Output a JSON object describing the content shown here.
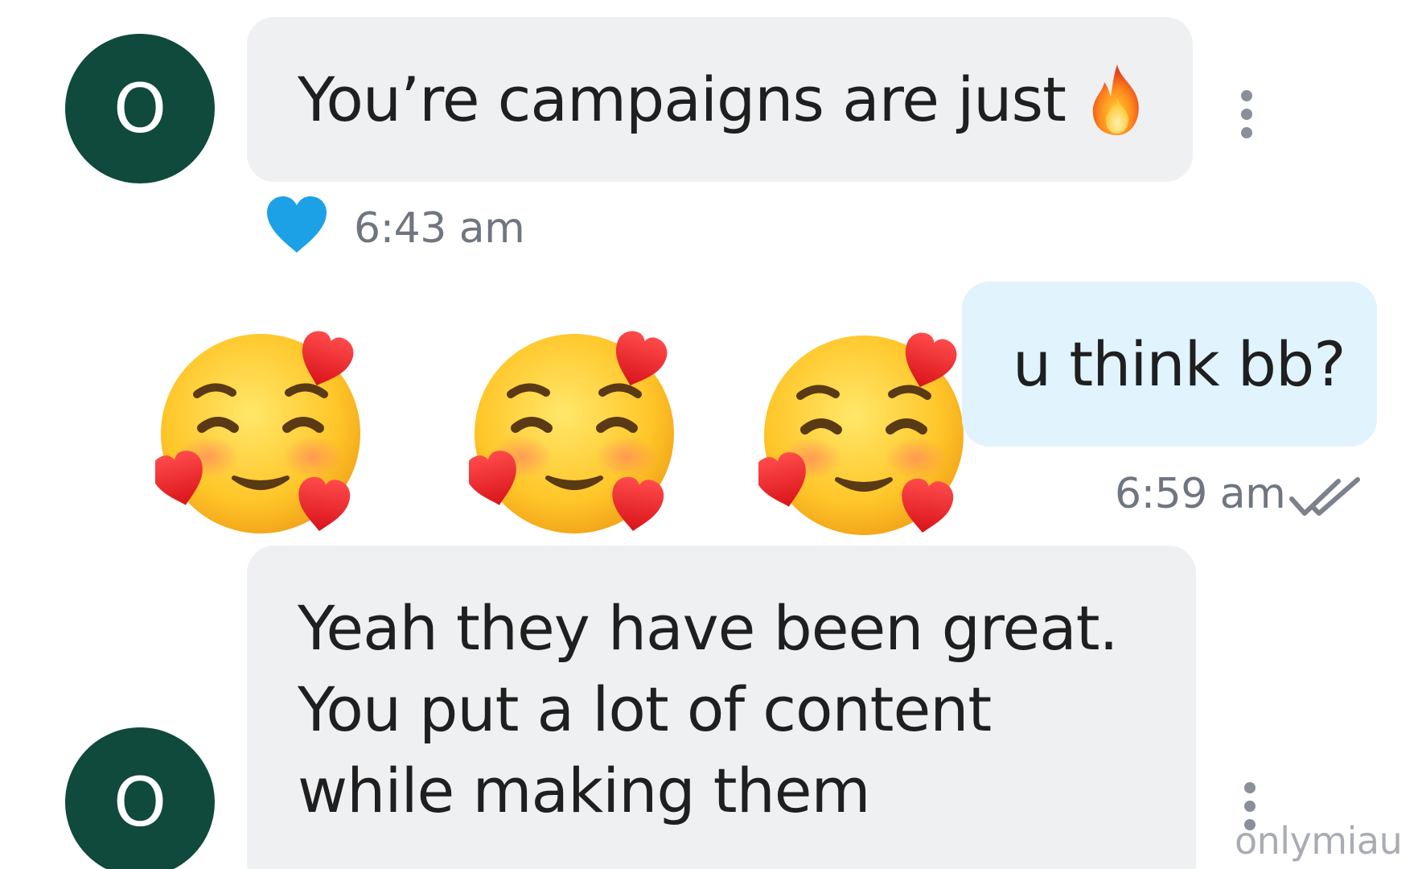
{
  "colors": {
    "avatar_bg": "#0f4a3c",
    "incoming_bubble": "#eff0f2",
    "outgoing_bubble": "#e1f3fc",
    "reaction_heart": "#1da1e6",
    "timestamp": "#6f7680"
  },
  "messages": [
    {
      "direction": "incoming",
      "avatar_letter": "O",
      "text": "You’re campaigns are just",
      "emoji": "fire-icon",
      "reaction": "blue-heart-icon",
      "time": "6:43 am"
    },
    {
      "direction": "outgoing",
      "emojis": [
        "smiling-face-with-hearts-icon",
        "smiling-face-with-hearts-icon",
        "smiling-face-with-hearts-icon"
      ],
      "text": "u think bb?",
      "time": "6:59 am",
      "status": "read-double-check-icon"
    },
    {
      "direction": "incoming",
      "avatar_letter": "O",
      "lines": [
        "Yeah they have been great.",
        "You put a lot of content",
        "while making them"
      ]
    }
  ],
  "watermark": "onlymiau"
}
